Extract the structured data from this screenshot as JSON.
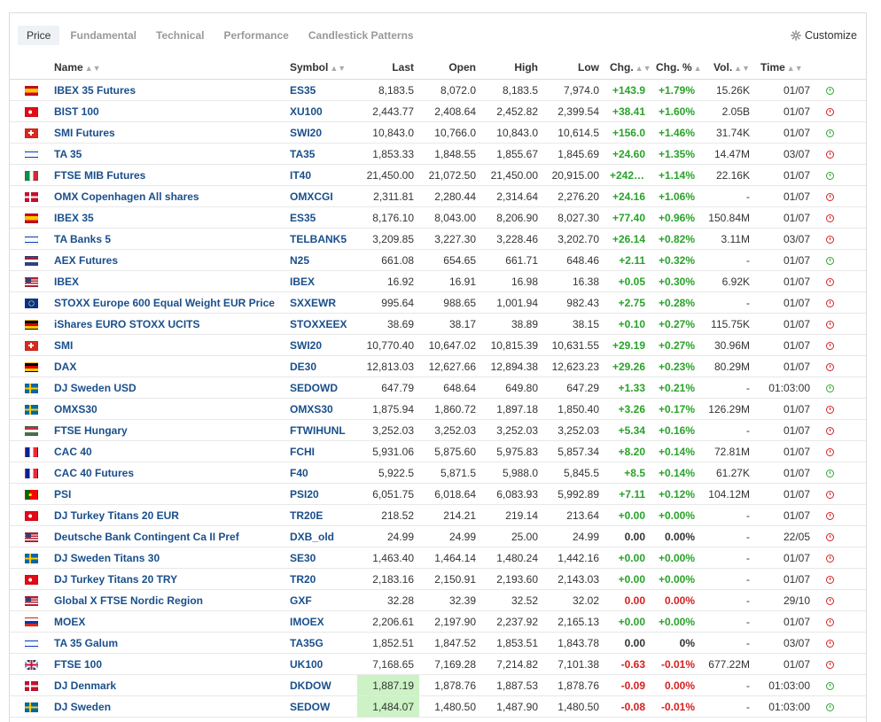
{
  "tabs": [
    {
      "label": "Price",
      "active": true
    },
    {
      "label": "Fundamental",
      "active": false
    },
    {
      "label": "Technical",
      "active": false
    },
    {
      "label": "Performance",
      "active": false
    },
    {
      "label": "Candlestick Patterns",
      "active": false
    }
  ],
  "customize_label": "Customize",
  "columns": {
    "name": "Name",
    "symbol": "Symbol",
    "last": "Last",
    "open": "Open",
    "high": "High",
    "low": "Low",
    "chg": "Chg.",
    "chgpct": "Chg. %",
    "vol": "Vol.",
    "time": "Time"
  },
  "colors": {
    "positive": "#29a329",
    "negative": "#d62020",
    "link": "#1a4f8b",
    "highlight": "#ccf2c5"
  },
  "rows": [
    {
      "flag": "spain",
      "name": "IBEX 35 Futures",
      "symbol": "ES35",
      "last": "8,183.5",
      "open": "8,072.0",
      "high": "8,183.5",
      "low": "7,974.0",
      "chg": "+143.9",
      "chgpct": "+1.79%",
      "vol": "15.26K",
      "time": "01/07",
      "dir": "pos",
      "status": "open"
    },
    {
      "flag": "turkey",
      "name": "BIST 100",
      "symbol": "XU100",
      "last": "2,443.77",
      "open": "2,408.64",
      "high": "2,452.82",
      "low": "2,399.54",
      "chg": "+38.41",
      "chgpct": "+1.60%",
      "vol": "2.05B",
      "time": "01/07",
      "dir": "pos",
      "status": "closed"
    },
    {
      "flag": "switzerland",
      "name": "SMI Futures",
      "symbol": "SWI20",
      "last": "10,843.0",
      "open": "10,766.0",
      "high": "10,843.0",
      "low": "10,614.5",
      "chg": "+156.0",
      "chgpct": "+1.46%",
      "vol": "31.74K",
      "time": "01/07",
      "dir": "pos",
      "status": "open"
    },
    {
      "flag": "israel",
      "name": "TA 35",
      "symbol": "TA35",
      "last": "1,853.33",
      "open": "1,848.55",
      "high": "1,855.67",
      "low": "1,845.69",
      "chg": "+24.60",
      "chgpct": "+1.35%",
      "vol": "14.47M",
      "time": "03/07",
      "dir": "pos",
      "status": "closed"
    },
    {
      "flag": "italy",
      "name": "FTSE MIB Futures",
      "symbol": "IT40",
      "last": "21,450.00",
      "open": "21,072.50",
      "high": "21,450.00",
      "low": "20,915.00",
      "chg": "+242.00",
      "chgpct": "+1.14%",
      "vol": "22.16K",
      "time": "01/07",
      "dir": "pos",
      "status": "open"
    },
    {
      "flag": "denmark",
      "name": "OMX Copenhagen All shares",
      "symbol": "OMXCGI",
      "last": "2,311.81",
      "open": "2,280.44",
      "high": "2,314.64",
      "low": "2,276.20",
      "chg": "+24.16",
      "chgpct": "+1.06%",
      "vol": "-",
      "time": "01/07",
      "dir": "pos",
      "status": "closed"
    },
    {
      "flag": "spain",
      "name": "IBEX 35",
      "symbol": "ES35",
      "last": "8,176.10",
      "open": "8,043.00",
      "high": "8,206.90",
      "low": "8,027.30",
      "chg": "+77.40",
      "chgpct": "+0.96%",
      "vol": "150.84M",
      "time": "01/07",
      "dir": "pos",
      "status": "closed"
    },
    {
      "flag": "israel",
      "name": "TA Banks 5",
      "symbol": "TELBANK5",
      "last": "3,209.85",
      "open": "3,227.30",
      "high": "3,228.46",
      "low": "3,202.70",
      "chg": "+26.14",
      "chgpct": "+0.82%",
      "vol": "3.11M",
      "time": "03/07",
      "dir": "pos",
      "status": "closed"
    },
    {
      "flag": "netherlands",
      "name": "AEX Futures",
      "symbol": "N25",
      "last": "661.08",
      "open": "654.65",
      "high": "661.71",
      "low": "648.46",
      "chg": "+2.11",
      "chgpct": "+0.32%",
      "vol": "-",
      "time": "01/07",
      "dir": "pos",
      "status": "open"
    },
    {
      "flag": "usa",
      "name": "IBEX",
      "symbol": "IBEX",
      "last": "16.92",
      "open": "16.91",
      "high": "16.98",
      "low": "16.38",
      "chg": "+0.05",
      "chgpct": "+0.30%",
      "vol": "6.92K",
      "time": "01/07",
      "dir": "pos",
      "status": "closed"
    },
    {
      "flag": "eu",
      "name": "STOXX Europe 600 Equal Weight EUR Price",
      "symbol": "SXXEWR",
      "last": "995.64",
      "open": "988.65",
      "high": "1,001.94",
      "low": "982.43",
      "chg": "+2.75",
      "chgpct": "+0.28%",
      "vol": "-",
      "time": "01/07",
      "dir": "pos",
      "status": "closed"
    },
    {
      "flag": "germany",
      "name": "iShares EURO STOXX UCITS",
      "symbol": "STOXXEEX",
      "last": "38.69",
      "open": "38.17",
      "high": "38.89",
      "low": "38.15",
      "chg": "+0.10",
      "chgpct": "+0.27%",
      "vol": "115.75K",
      "time": "01/07",
      "dir": "pos",
      "status": "closed"
    },
    {
      "flag": "switzerland",
      "name": "SMI",
      "symbol": "SWI20",
      "last": "10,770.40",
      "open": "10,647.02",
      "high": "10,815.39",
      "low": "10,631.55",
      "chg": "+29.19",
      "chgpct": "+0.27%",
      "vol": "30.96M",
      "time": "01/07",
      "dir": "pos",
      "status": "closed"
    },
    {
      "flag": "germany",
      "name": "DAX",
      "symbol": "DE30",
      "last": "12,813.03",
      "open": "12,627.66",
      "high": "12,894.38",
      "low": "12,623.23",
      "chg": "+29.26",
      "chgpct": "+0.23%",
      "vol": "80.29M",
      "time": "01/07",
      "dir": "pos",
      "status": "closed"
    },
    {
      "flag": "sweden",
      "name": "DJ Sweden USD",
      "symbol": "SEDOWD",
      "last": "647.79",
      "open": "648.64",
      "high": "649.80",
      "low": "647.29",
      "chg": "+1.33",
      "chgpct": "+0.21%",
      "vol": "-",
      "time": "01:03:00",
      "dir": "pos",
      "status": "open"
    },
    {
      "flag": "sweden",
      "name": "OMXS30",
      "symbol": "OMXS30",
      "last": "1,875.94",
      "open": "1,860.72",
      "high": "1,897.18",
      "low": "1,850.40",
      "chg": "+3.26",
      "chgpct": "+0.17%",
      "vol": "126.29M",
      "time": "01/07",
      "dir": "pos",
      "status": "closed"
    },
    {
      "flag": "hungary",
      "name": "FTSE Hungary",
      "symbol": "FTWIHUNL",
      "last": "3,252.03",
      "open": "3,252.03",
      "high": "3,252.03",
      "low": "3,252.03",
      "chg": "+5.34",
      "chgpct": "+0.16%",
      "vol": "-",
      "time": "01/07",
      "dir": "pos",
      "status": "closed"
    },
    {
      "flag": "france",
      "name": "CAC 40",
      "symbol": "FCHI",
      "last": "5,931.06",
      "open": "5,875.60",
      "high": "5,975.83",
      "low": "5,857.34",
      "chg": "+8.20",
      "chgpct": "+0.14%",
      "vol": "72.81M",
      "time": "01/07",
      "dir": "pos",
      "status": "closed"
    },
    {
      "flag": "france",
      "name": "CAC 40 Futures",
      "symbol": "F40",
      "last": "5,922.5",
      "open": "5,871.5",
      "high": "5,988.0",
      "low": "5,845.5",
      "chg": "+8.5",
      "chgpct": "+0.14%",
      "vol": "61.27K",
      "time": "01/07",
      "dir": "pos",
      "status": "open"
    },
    {
      "flag": "portugal",
      "name": "PSI",
      "symbol": "PSI20",
      "last": "6,051.75",
      "open": "6,018.64",
      "high": "6,083.93",
      "low": "5,992.89",
      "chg": "+7.11",
      "chgpct": "+0.12%",
      "vol": "104.12M",
      "time": "01/07",
      "dir": "pos",
      "status": "closed"
    },
    {
      "flag": "turkey",
      "name": "DJ Turkey Titans 20 EUR",
      "symbol": "TR20E",
      "last": "218.52",
      "open": "214.21",
      "high": "219.14",
      "low": "213.64",
      "chg": "+0.00",
      "chgpct": "+0.00%",
      "vol": "-",
      "time": "01/07",
      "dir": "pos",
      "status": "closed"
    },
    {
      "flag": "usa",
      "name": "Deutsche Bank Contingent Ca II Pref",
      "symbol": "DXB_old",
      "last": "24.99",
      "open": "24.99",
      "high": "25.00",
      "low": "24.99",
      "chg": "0.00",
      "chgpct": "0.00%",
      "vol": "-",
      "time": "22/05",
      "dir": "flat",
      "status": "closed"
    },
    {
      "flag": "sweden",
      "name": "DJ Sweden Titans 30",
      "symbol": "SE30",
      "last": "1,463.40",
      "open": "1,464.14",
      "high": "1,480.24",
      "low": "1,442.16",
      "chg": "+0.00",
      "chgpct": "+0.00%",
      "vol": "-",
      "time": "01/07",
      "dir": "pos",
      "status": "closed"
    },
    {
      "flag": "turkey",
      "name": "DJ Turkey Titans 20 TRY",
      "symbol": "TR20",
      "last": "2,183.16",
      "open": "2,150.91",
      "high": "2,193.60",
      "low": "2,143.03",
      "chg": "+0.00",
      "chgpct": "+0.00%",
      "vol": "-",
      "time": "01/07",
      "dir": "pos",
      "status": "closed"
    },
    {
      "flag": "usa",
      "name": "Global X FTSE Nordic Region",
      "symbol": "GXF",
      "last": "32.28",
      "open": "32.39",
      "high": "32.52",
      "low": "32.02",
      "chg": "0.00",
      "chgpct": "0.00%",
      "vol": "-",
      "time": "29/10",
      "dir": "neg",
      "status": "closed"
    },
    {
      "flag": "russia",
      "name": "MOEX",
      "symbol": "IMOEX",
      "last": "2,206.61",
      "open": "2,197.90",
      "high": "2,237.92",
      "low": "2,165.13",
      "chg": "+0.00",
      "chgpct": "+0.00%",
      "vol": "-",
      "time": "01/07",
      "dir": "pos",
      "status": "closed"
    },
    {
      "flag": "israel",
      "name": "TA 35 Galum",
      "symbol": "TA35G",
      "last": "1,852.51",
      "open": "1,847.52",
      "high": "1,853.51",
      "low": "1,843.78",
      "chg": "0.00",
      "chgpct": "0%",
      "vol": "-",
      "time": "03/07",
      "dir": "flat",
      "status": "closed"
    },
    {
      "flag": "uk",
      "name": "FTSE 100",
      "symbol": "UK100",
      "last": "7,168.65",
      "open": "7,169.28",
      "high": "7,214.82",
      "low": "7,101.38",
      "chg": "-0.63",
      "chgpct": "-0.01%",
      "vol": "677.22M",
      "time": "01/07",
      "dir": "neg",
      "status": "closed"
    },
    {
      "flag": "denmark",
      "name": "DJ Denmark",
      "symbol": "DKDOW",
      "last": "1,887.19",
      "open": "1,878.76",
      "high": "1,887.53",
      "low": "1,878.76",
      "chg": "-0.09",
      "chgpct": "0.00%",
      "vol": "-",
      "time": "01:03:00",
      "dir": "neg",
      "status": "open",
      "highlight_last": true
    },
    {
      "flag": "sweden",
      "name": "DJ Sweden",
      "symbol": "SEDOW",
      "last": "1,484.07",
      "open": "1,480.50",
      "high": "1,487.90",
      "low": "1,480.50",
      "chg": "-0.08",
      "chgpct": "-0.01%",
      "vol": "-",
      "time": "01:03:00",
      "dir": "neg",
      "status": "open",
      "highlight_last": true
    }
  ]
}
